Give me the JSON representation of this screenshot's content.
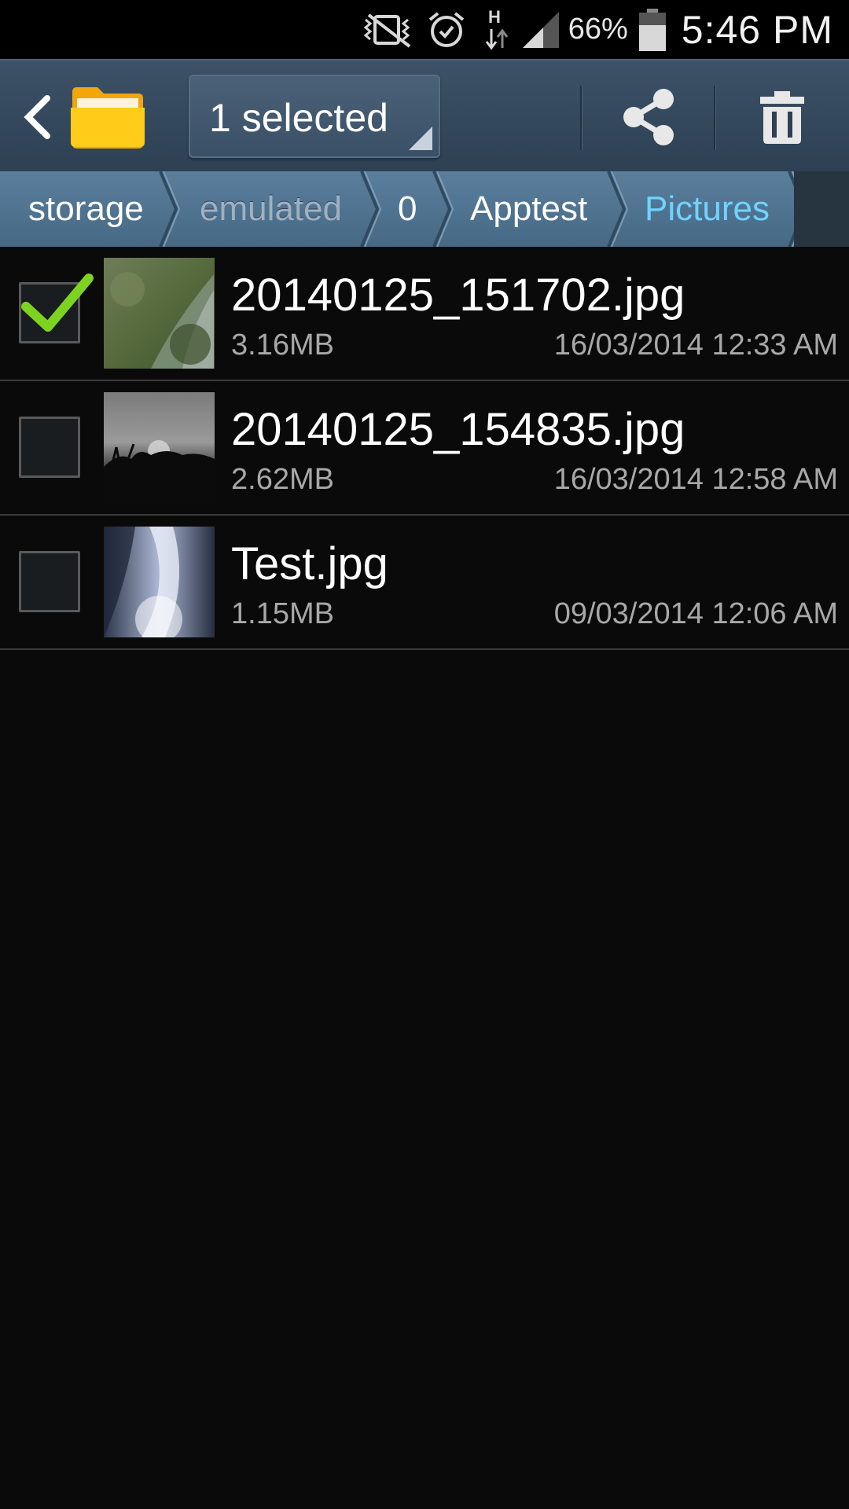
{
  "status_bar": {
    "battery_percent": "66%",
    "time": "5:46 PM",
    "icons": [
      "vibrate-icon",
      "alarm-icon",
      "hspa-data-icon",
      "signal-icon",
      "battery-icon"
    ]
  },
  "action_bar": {
    "selection_label": "1 selected",
    "icons": [
      "back-icon",
      "folder-icon",
      "share-icon",
      "delete-icon"
    ]
  },
  "breadcrumb": {
    "items": [
      {
        "label": "storage",
        "state": "normal"
      },
      {
        "label": "emulated",
        "state": "dim"
      },
      {
        "label": "0",
        "state": "normal"
      },
      {
        "label": "Apptest",
        "state": "normal"
      },
      {
        "label": "Pictures",
        "state": "active"
      }
    ]
  },
  "files": [
    {
      "name": "20140125_151702.jpg",
      "size": "3.16MB",
      "date": "16/03/2014 12:33 AM",
      "checked": true
    },
    {
      "name": "20140125_154835.jpg",
      "size": "2.62MB",
      "date": "16/03/2014 12:58 AM",
      "checked": false
    },
    {
      "name": "Test.jpg",
      "size": "1.15MB",
      "date": "09/03/2014 12:06 AM",
      "checked": false
    }
  ],
  "colors": {
    "action_bar": "#34495e",
    "breadcrumb": "#4f7391",
    "active_crumb": "#6fd3ff",
    "checkmark": "#7ed321",
    "background": "#0a0a0a"
  }
}
